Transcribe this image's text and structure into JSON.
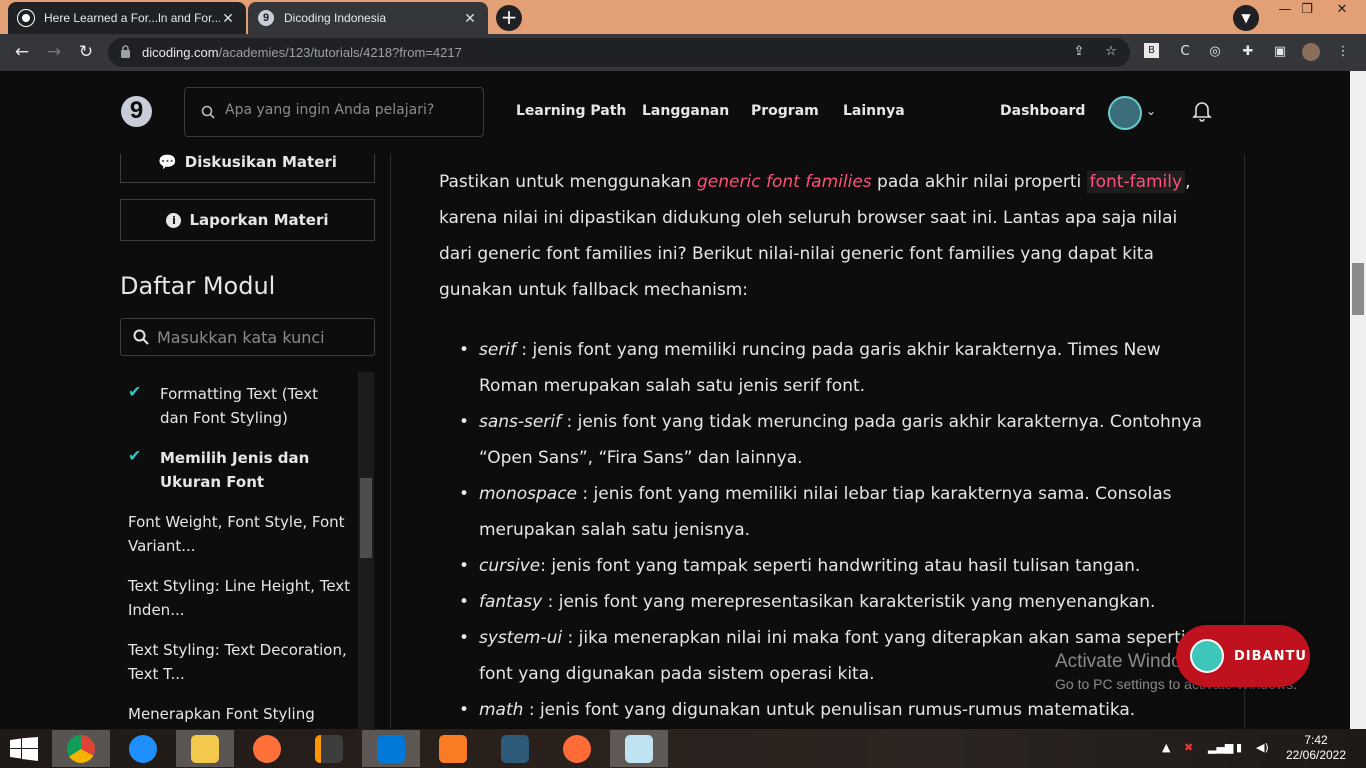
{
  "browser": {
    "tabs": [
      {
        "title": "Here Learned a For...ln and For...d",
        "close": "✕"
      },
      {
        "title": "Dicoding Indonesia",
        "close": "✕"
      }
    ],
    "new_tab": "+",
    "address": {
      "domain": "dicoding.com",
      "path": "/academies/123/tutorials/4218?from=4217"
    }
  },
  "header": {
    "logo": "9",
    "search_placeholder": "Apa yang ingin Anda pelajari?",
    "nav": [
      "Learning Path",
      "Langganan",
      "Program",
      "Lainnya"
    ],
    "dashboard": "Dashboard"
  },
  "sidebar": {
    "discuss_btn": "Diskusikan Materi",
    "report_btn": "Laporkan Materi",
    "module_title": "Daftar Modul",
    "module_search_placeholder": "Masukkan kata kunci",
    "modules": [
      {
        "label": "Formatting Text (Text dan Font Styling)",
        "done": true
      },
      {
        "label": "Memilih Jenis dan Ukuran Font",
        "done": true,
        "active": true
      },
      {
        "label": "Font Weight, Font Style, Font Variant...",
        "done": false
      },
      {
        "label": "Text Styling: Line Height, Text Inden...",
        "done": false
      },
      {
        "label": "Text Styling: Text Decoration, Text T...",
        "done": false
      },
      {
        "label": "Menerapkan Font Styling",
        "done": false
      }
    ]
  },
  "content": {
    "p_before": "Pastikan untuk menggunakan ",
    "p_link": "generic font families",
    "p_mid": " pada akhir nilai properti ",
    "p_code": "font-family",
    "p_after": ", karena nilai ini dipastikan didukung oleh seluruh browser saat ini. Lantas apa saja nilai dari generic font families ini? Berikut nilai-nilai generic font families yang dapat kita gunakan untuk fallback mechanism:",
    "bullets": [
      {
        "term": "serif",
        "desc": " : jenis font yang memiliki runcing pada garis akhir karakternya. Times New Roman merupakan salah satu jenis serif font."
      },
      {
        "term": "sans-serif",
        "desc": " : jenis font yang tidak meruncing pada garis akhir karakternya. Contohnya “Open Sans”, “Fira Sans” dan lainnya."
      },
      {
        "term": "monospace",
        "desc": " : jenis font yang memiliki nilai lebar tiap karakternya sama. Consolas merupakan salah satu jenisnya."
      },
      {
        "term": "cursive",
        "desc": ": jenis font yang tampak seperti handwriting atau hasil tulisan tangan."
      },
      {
        "term": "fantasy",
        "desc": " : jenis font yang merepresentasikan karakteristik yang menyenangkan."
      },
      {
        "term": "system-ui",
        "desc": " : jika menerapkan nilai ini maka font yang diterapkan akan sama seperti font yang digunakan pada sistem operasi kita."
      },
      {
        "term": "math",
        "desc": " : jenis font yang digunakan untuk penulisan rumus-rumus matematika."
      }
    ]
  },
  "help_button": "DIBANTU",
  "watermark": {
    "line1": "Activate Windows",
    "line2": "Go to PC settings to activate Windows."
  },
  "taskbar": {
    "time": "7:42",
    "date": "22/06/2022"
  },
  "colors": {
    "accent": "#ff4f7b",
    "check": "#2ec4c4",
    "help": "#c0111f"
  }
}
